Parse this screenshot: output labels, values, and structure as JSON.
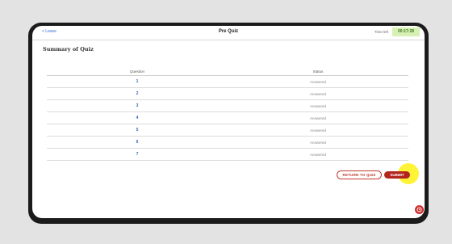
{
  "header": {
    "back_label": "< Leave",
    "title": "Pre Quiz",
    "time_left_label": "Time left",
    "timer_value": "00:17:28"
  },
  "summary": {
    "title": "Summary of Quiz",
    "columns": [
      "Question",
      "Status"
    ],
    "rows": [
      {
        "question": "1",
        "status": "Answered"
      },
      {
        "question": "2",
        "status": "Answered"
      },
      {
        "question": "3",
        "status": "Answered"
      },
      {
        "question": "4",
        "status": "Answered"
      },
      {
        "question": "5",
        "status": "Answered"
      },
      {
        "question": "6",
        "status": "Answered"
      },
      {
        "question": "7",
        "status": "Answered"
      }
    ]
  },
  "actions": {
    "return_label": "RETURN TO QUIZ",
    "submit_label": "SUBMIT"
  },
  "colors": {
    "accent": "#b3261e",
    "link": "#2f6fd6",
    "timer_bg": "#d7f0b4"
  },
  "icons": {
    "help": "help-chat-icon"
  }
}
